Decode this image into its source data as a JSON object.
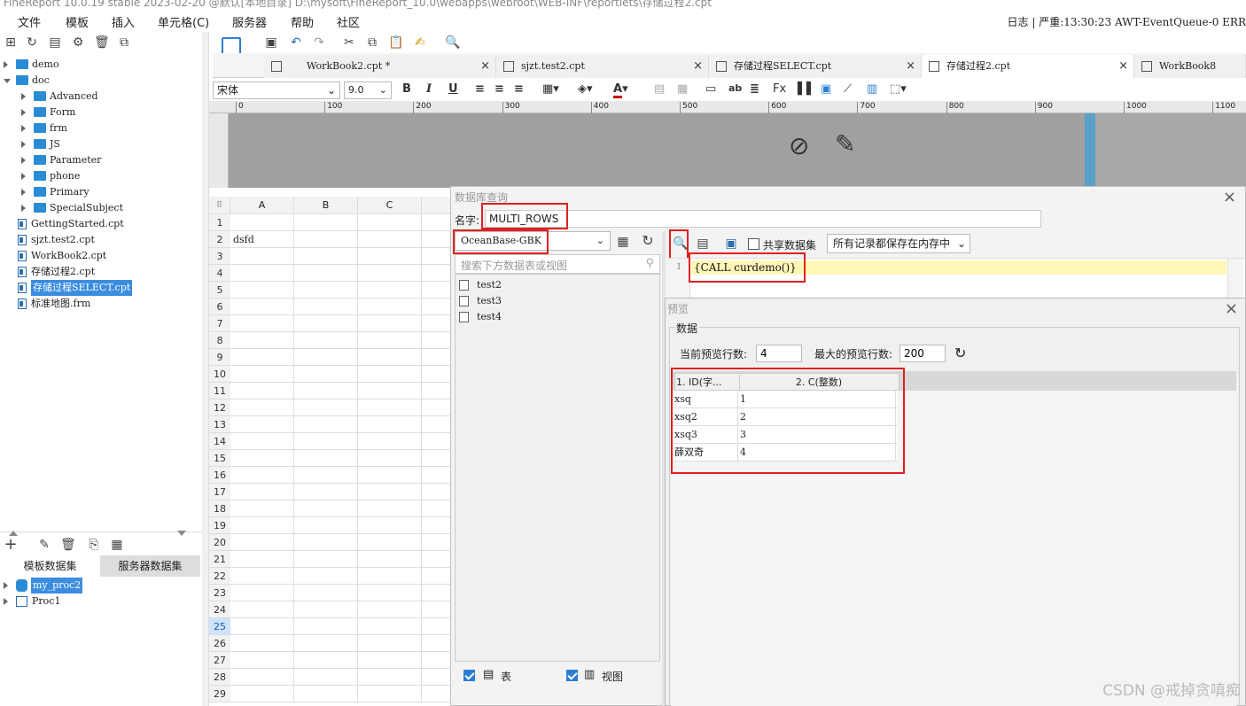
{
  "window": {
    "title": "FineReport 10.0.19 stable 2023-02-20 @默认[本地目录]     D:\\mysoft\\FineReport_10.0\\webapps\\webroot\\WEB-INF\\reportlets\\存储过程2.cpt"
  },
  "menu": [
    "文件",
    "模板",
    "插入",
    "单元格(C)",
    "服务器",
    "帮助",
    "社区"
  ],
  "status": "日志 | 严重:13:30:23 AWT-EventQueue-0 ERR",
  "tree": [
    {
      "label": "demo",
      "type": "folder",
      "level": 0,
      "expanded": false
    },
    {
      "label": "doc",
      "type": "folder",
      "level": 0,
      "expanded": true
    },
    {
      "label": "Advanced",
      "type": "folder",
      "level": 1
    },
    {
      "label": "Form",
      "type": "folder",
      "level": 1
    },
    {
      "label": "frm",
      "type": "folder",
      "level": 1
    },
    {
      "label": "JS",
      "type": "folder",
      "level": 1
    },
    {
      "label": "Parameter",
      "type": "folder",
      "level": 1
    },
    {
      "label": "phone",
      "type": "folder",
      "level": 1
    },
    {
      "label": "Primary",
      "type": "folder",
      "level": 1
    },
    {
      "label": "SpecialSubject",
      "type": "folder",
      "level": 1
    },
    {
      "label": "GettingStarted.cpt",
      "type": "file",
      "level": 0
    },
    {
      "label": "sjzt.test2.cpt",
      "type": "file",
      "level": 0
    },
    {
      "label": "WorkBook2.cpt",
      "type": "file",
      "level": 0
    },
    {
      "label": "存储过程2.cpt",
      "type": "file",
      "level": 0
    },
    {
      "label": "存储过程SELECT.cpt",
      "type": "file",
      "level": 0,
      "selected": true
    },
    {
      "label": "标准地图.frm",
      "type": "file",
      "level": 0
    }
  ],
  "dataset_tabs": {
    "template": "模板数据集",
    "server": "服务器数据集"
  },
  "datasets": [
    {
      "label": "my_proc2",
      "selected": true
    },
    {
      "label": "Proc1",
      "selected": false
    }
  ],
  "tabs": [
    {
      "label": "WorkBook2.cpt *",
      "active": false
    },
    {
      "label": "sjzt.test2.cpt",
      "active": false
    },
    {
      "label": "存储过程SELECT.cpt",
      "active": false
    },
    {
      "label": "存储过程2.cpt",
      "active": true
    },
    {
      "label": "WorkBook8",
      "active": false
    }
  ],
  "format": {
    "font": "宋体",
    "size": "9.0"
  },
  "ruler": [
    "0",
    "100",
    "200",
    "300",
    "400",
    "500",
    "600",
    "700",
    "800",
    "900",
    "1000",
    "1100"
  ],
  "sheet": {
    "columns": [
      "A",
      "B",
      "C"
    ],
    "rows": [
      "1",
      "2",
      "3",
      "4",
      "5",
      "6",
      "7",
      "8",
      "9",
      "10",
      "11",
      "12",
      "13",
      "14",
      "15",
      "16",
      "17",
      "18",
      "19",
      "20",
      "21",
      "22",
      "23",
      "24",
      "25",
      "26",
      "27",
      "28",
      "29"
    ],
    "a2": "dsfd",
    "selected_row": "25"
  },
  "dbquery": {
    "title": "数据库查询",
    "name_label": "名字:",
    "name_value": "MULTI_ROWS",
    "connection": "OceanBase-GBK",
    "search_placeholder": "搜索下方数据表或视图",
    "tables": [
      "test2",
      "test3",
      "test4"
    ],
    "shared_label": "共享数据集",
    "memory_option": "所有记录都保存在内存中",
    "sql_line_no": "1",
    "sql_text": "{CALL curdemo()}",
    "table_check_label": "表",
    "view_check_label": "视图"
  },
  "preview": {
    "title": "预览",
    "section": "数据",
    "current_rows_label": "当前预览行数:",
    "current_rows": "4",
    "max_rows_label": "最大的预览行数:",
    "max_rows": "200",
    "headers": [
      "1. ID(字...",
      "2. C(整数)"
    ],
    "rows": [
      [
        "xsq",
        "1"
      ],
      [
        "xsq2",
        "2"
      ],
      [
        "xsq3",
        "3"
      ],
      [
        "薛双奇",
        "4"
      ]
    ]
  },
  "watermark": "CSDN @戒掉贪嗔痴"
}
